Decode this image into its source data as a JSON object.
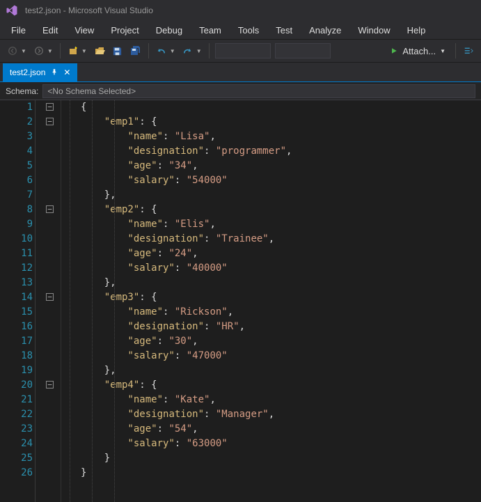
{
  "title": "test2.json - Microsoft Visual Studio",
  "menu": [
    "File",
    "Edit",
    "View",
    "Project",
    "Debug",
    "Team",
    "Tools",
    "Test",
    "Analyze",
    "Window",
    "Help"
  ],
  "toolbar": {
    "attach_label": "Attach..."
  },
  "tab": {
    "filename": "test2.json"
  },
  "schema": {
    "label": "Schema:",
    "value": "<No Schema Selected>"
  },
  "editor": {
    "json": {
      "emp1": {
        "name": "Lisa",
        "designation": "programmer",
        "age": "34",
        "salary": "54000"
      },
      "emp2": {
        "name": "Elis",
        "designation": "Trainee",
        "age": "24",
        "salary": "40000"
      },
      "emp3": {
        "name": "Rickson",
        "designation": "HR",
        "age": "30",
        "salary": "47000"
      },
      "emp4": {
        "name": "Kate",
        "designation": "Manager",
        "age": "54",
        "salary": "63000"
      }
    },
    "total_lines": 26
  }
}
